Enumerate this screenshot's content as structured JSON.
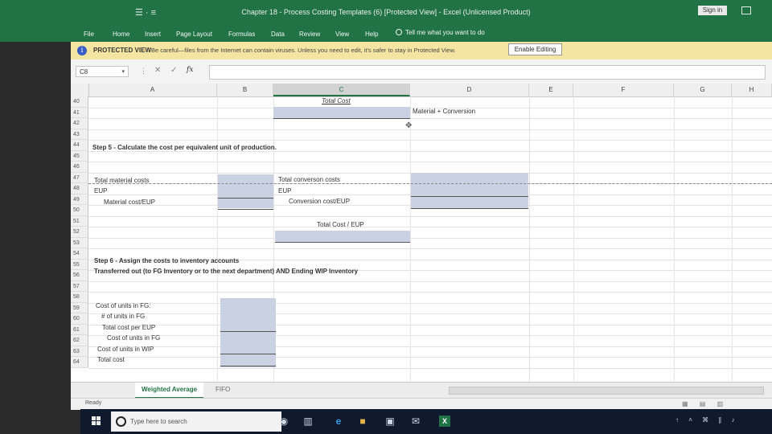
{
  "window": {
    "title": "Chapter 18 - Process Costing Templates (6) [Protected View] - Excel (Unlicensed Product)",
    "signin": "Sign in",
    "qat": "☰ · ≡"
  },
  "ribbon": {
    "tabs": [
      "File",
      "Home",
      "Insert",
      "Page Layout",
      "Formulas",
      "Data",
      "Review",
      "View",
      "Help"
    ],
    "tellme": "Tell me what you want to do"
  },
  "protected_view": {
    "icon": "i",
    "label": "PROTECTED VIEW",
    "message": "Be careful—files from the Internet can contain viruses. Unless you need to edit, it's safer to stay in Protected View.",
    "button": "Enable Editing"
  },
  "formula_bar": {
    "namebox": "C8",
    "namebox_arrow": "▾",
    "dots": "⋮",
    "cancel": "✕",
    "enter": "✓",
    "fx": "fx",
    "value": ""
  },
  "sheet": {
    "columns": [
      "A",
      "B",
      "C",
      "D",
      "E",
      "F",
      "G",
      "H"
    ],
    "rows": [
      "40",
      "41",
      "42",
      "43",
      "44",
      "45",
      "46",
      "47",
      "48",
      "49",
      "50",
      "51",
      "52",
      "53",
      "54",
      "55",
      "56",
      "57",
      "58",
      "59",
      "60",
      "61",
      "62",
      "63",
      "64"
    ],
    "cells": {
      "c40": "Total Cost",
      "d41": "Material + Conversion",
      "a44": "Step 5 - Calculate the cost per equivalent unit of production.",
      "a47": "Total material costs",
      "a48": "EUP",
      "a49": "Material cost/EUP",
      "c47": "Total converson costs",
      "c48": "EUP",
      "c49": "Conversion cost/EUP",
      "c51": "Total Cost / EUP",
      "a54": "Step 6 - Assign the costs to inventory accounts",
      "a55": "Transferred out (to FG Inventory or to the next department) AND Ending WIP Inventory",
      "a58": "Cost of units in FG:",
      "a59": "# of units in FG",
      "a60": "Total cost per EUP",
      "a61": "Cost of units in FG",
      "a62": "Cost of units in WIP",
      "a63": "Total cost"
    }
  },
  "sheet_tabs": [
    "Weighted Average",
    "FIFO"
  ],
  "status": {
    "ready": "Ready",
    "views": "▦ ▤ ▥"
  },
  "taskbar": {
    "search_placeholder": "Type here to search",
    "icons": [
      "◉",
      "▥",
      "e",
      "■",
      "▣",
      "✉",
      "X"
    ],
    "tray": "↑ ˄ ⌘ ∥ ♪"
  },
  "colors": {
    "excel_green": "#217346",
    "protected_yellow": "#f4e6a2",
    "input_shade": "#c9d1e3"
  }
}
